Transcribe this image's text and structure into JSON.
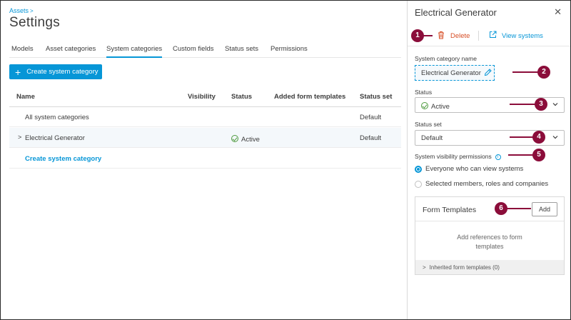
{
  "breadcrumb": {
    "label": "Assets"
  },
  "page_title": "Settings",
  "tabs": [
    {
      "label": "Models"
    },
    {
      "label": "Asset categories"
    },
    {
      "label": "System categories"
    },
    {
      "label": "Custom fields"
    },
    {
      "label": "Status sets"
    },
    {
      "label": "Permissions"
    }
  ],
  "active_tab": "System categories",
  "create_button": {
    "label": "Create system category"
  },
  "table": {
    "columns": [
      "Name",
      "Visibility",
      "Status",
      "Added form templates",
      "Status set"
    ],
    "rows": [
      {
        "name": "All system categories",
        "visibility": "",
        "status": "",
        "templates": "",
        "status_set": "Default"
      },
      {
        "name": "Electrical Generator",
        "visibility": "",
        "status": "Active",
        "templates": "",
        "status_set": "Default"
      }
    ],
    "add_link": "Create system category"
  },
  "panel": {
    "title": "Electrical Generator",
    "delete_label": "Delete",
    "view_label": "View systems",
    "name_label": "System category name",
    "name_value": "Electrical Generator",
    "status_label": "Status",
    "status_value": "Active",
    "status_set_label": "Status set",
    "status_set_value": "Default",
    "visibility_label": "System visibility permissions",
    "visibility_options": [
      {
        "label": "Everyone who can view systems",
        "selected": true
      },
      {
        "label": "Selected members, roles and companies",
        "selected": false
      }
    ],
    "form_templates": {
      "title": "Form Templates",
      "add_label": "Add",
      "empty_line1": "Add references to form",
      "empty_line2": "templates",
      "inherited": "Inherited form templates (0)"
    }
  },
  "callouts": [
    "1",
    "2",
    "3",
    "4",
    "5",
    "6"
  ],
  "colors": {
    "accent": "#0696d7",
    "danger": "#d74e26",
    "success": "#4e9a3e",
    "callout": "#8b0d3a"
  }
}
